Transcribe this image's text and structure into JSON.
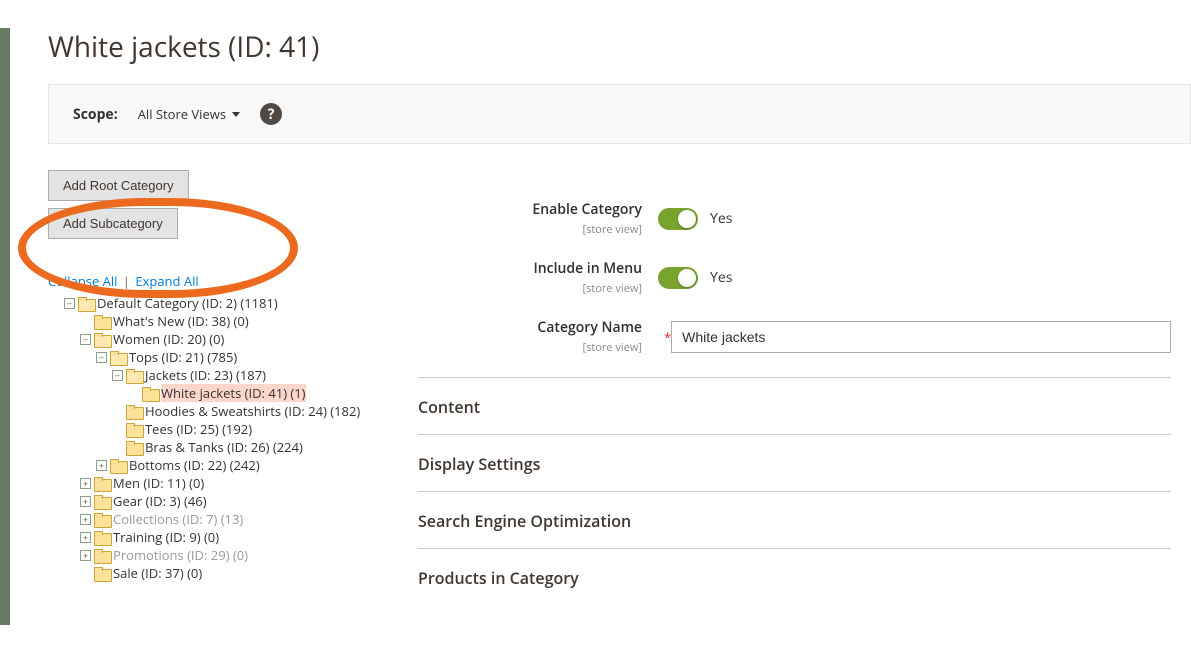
{
  "page_title": "White jackets (ID: 41)",
  "scope": {
    "label": "Scope:",
    "value": "All Store Views"
  },
  "buttons": {
    "add_root": "Add Root Category",
    "add_sub": "Add Subcategory"
  },
  "tree_actions": {
    "collapse": "Collapse All",
    "expand": "Expand All"
  },
  "tree": {
    "root": "Default Category (ID: 2) (1181)",
    "whats_new": "What's New (ID: 38) (0)",
    "women": "Women (ID: 20) (0)",
    "tops": "Tops (ID: 21) (785)",
    "jackets": "Jackets (ID: 23) (187)",
    "white_jackets": "White jackets (ID: 41) (1)",
    "hoodies": "Hoodies & Sweatshirts (ID: 24) (182)",
    "tees": "Tees (ID: 25) (192)",
    "bras": "Bras & Tanks (ID: 26) (224)",
    "bottoms": "Bottoms (ID: 22) (242)",
    "men": "Men (ID: 11) (0)",
    "gear": "Gear (ID: 3) (46)",
    "collections": "Collections (ID: 7) (13)",
    "training": "Training (ID: 9) (0)",
    "promotions": "Promotions (ID: 29) (0)",
    "sale": "Sale (ID: 37) (0)"
  },
  "form": {
    "enable_category": {
      "label": "Enable Category",
      "hint": "[store view]",
      "value_text": "Yes"
    },
    "include_in_menu": {
      "label": "Include in Menu",
      "hint": "[store view]",
      "value_text": "Yes"
    },
    "category_name": {
      "label": "Category Name",
      "hint": "[store view]",
      "value": "White jackets"
    }
  },
  "sections": {
    "content": "Content",
    "display": "Display Settings",
    "seo": "Search Engine Optimization",
    "products": "Products in Category"
  }
}
